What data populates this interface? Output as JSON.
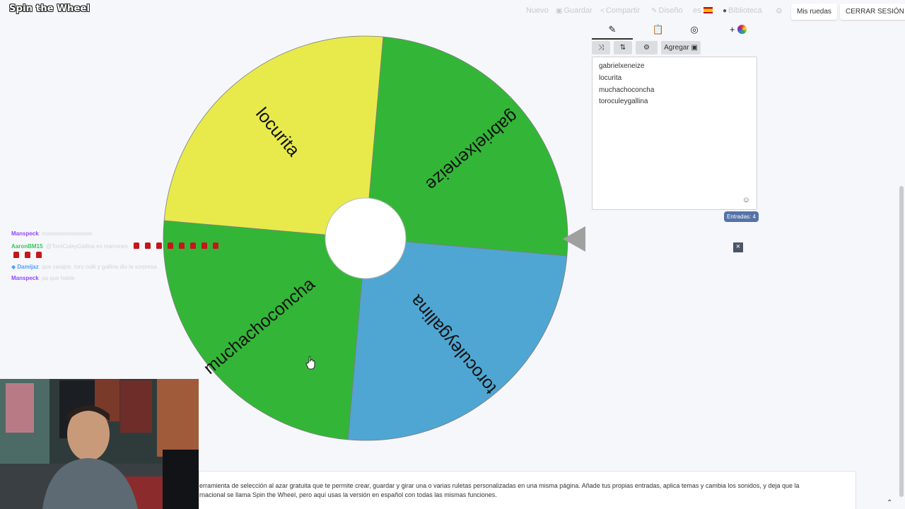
{
  "app": {
    "logo": "Spin the Wheel"
  },
  "topnav": {
    "items": [
      {
        "label": "Nuevo",
        "icon": ""
      },
      {
        "label": "Guardar",
        "icon": "save-icon"
      },
      {
        "label": "Compartir",
        "icon": "share-icon"
      },
      {
        "label": "Diseño",
        "icon": "pencil-icon"
      },
      {
        "label": "es",
        "icon": "spain-flag-icon"
      },
      {
        "label": "Biblioteca",
        "icon": "globe-icon"
      }
    ],
    "my_wheels": "Mis ruedas",
    "logout": "CERRAR SESIÓN"
  },
  "wheel": {
    "segments": [
      {
        "label": "gabrielxeneize",
        "color": "#33b637"
      },
      {
        "label": "toroculeygallina",
        "color": "#4fa6d2"
      },
      {
        "label": "muchachoconcha",
        "color": "#33b637"
      },
      {
        "label": "locurita",
        "color": "#e8ea4b"
      }
    ]
  },
  "editor": {
    "tabs": [
      {
        "name": "edit-tab",
        "icon": "pencil-icon"
      },
      {
        "name": "results-tab",
        "icon": "clipboard-icon"
      },
      {
        "name": "hide-tab",
        "icon": "eye-slash-icon"
      },
      {
        "name": "add-wheel-tab",
        "icon": "plus-color-wheel-icon"
      }
    ],
    "toolbar": {
      "shuffle": "shuffle-icon",
      "sort": "sort-icon",
      "settings": "gear-icon",
      "add_label": "Agregar"
    },
    "entries": [
      "gabrielxeneize",
      "locurita",
      "muchachoconcha",
      "toroculeygallina"
    ],
    "entries_badge": "Entradas: 4"
  },
  "chat": [
    {
      "user": "Manspeck",
      "user_color": "#9146ff",
      "text": ": nooooooooooooooo"
    },
    {
      "user": "AaronBM15",
      "user_color": "#36c65c",
      "text": ": @ToroCuleyGallina es marrones"
    },
    {
      "user": "Damijaz",
      "user_color": "#4f9cff",
      "text": ": que carajos. toro culé y gallina dio la sorpresa"
    },
    {
      "user": "Manspeck",
      "user_color": "#9146ff",
      "text": ": pa que hable"
    }
  ],
  "description": {
    "line1": "erramienta de selección al azar gratuita que te permite crear, guardar y girar una o varias ruletas personalizadas en una misma página. Añade tus propias entradas, aplica temas y cambia los sonidos, y deja que la",
    "line2": "rnacional se llama Spin the Wheel, pero aquí usas la versión en español con todas las mismas funciones."
  }
}
